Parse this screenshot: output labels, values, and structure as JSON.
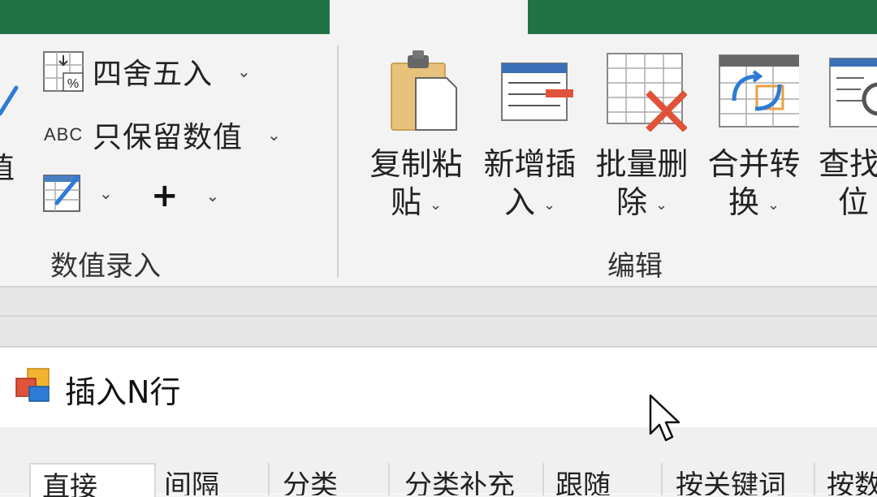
{
  "tabs": [
    {
      "label": "",
      "active": false
    },
    {
      "label": "",
      "active": false
    },
    {
      "label": "",
      "active": false
    },
    {
      "label": "",
      "active": true
    },
    {
      "label": "",
      "active": false
    },
    {
      "label": "",
      "active": false
    }
  ],
  "ribbon": {
    "round_label": "四舍五入",
    "keep_values_label": "只保留数值",
    "abc_label": "ABC",
    "plus_label": "+",
    "partial_left_label": "值",
    "group_numeric_label": "数值录入",
    "group_edit_label": "编辑",
    "buttons": [
      {
        "line1": "复制粘",
        "line2": "贴"
      },
      {
        "line1": "新增插",
        "line2": "入"
      },
      {
        "line1": "批量删",
        "line2": "除"
      },
      {
        "line1": "合并转",
        "line2": "换"
      },
      {
        "line1": "查找",
        "line2": "位"
      }
    ]
  },
  "dialog": {
    "title": "插入N行",
    "tabs": [
      "直接",
      "间隔",
      "分类",
      "分类补充",
      "跟随",
      "按关键词",
      "按数"
    ]
  },
  "colors": {
    "tab_bar": "#217346",
    "accent_red": "#e0533a",
    "accent_blue": "#2e7bd6"
  }
}
